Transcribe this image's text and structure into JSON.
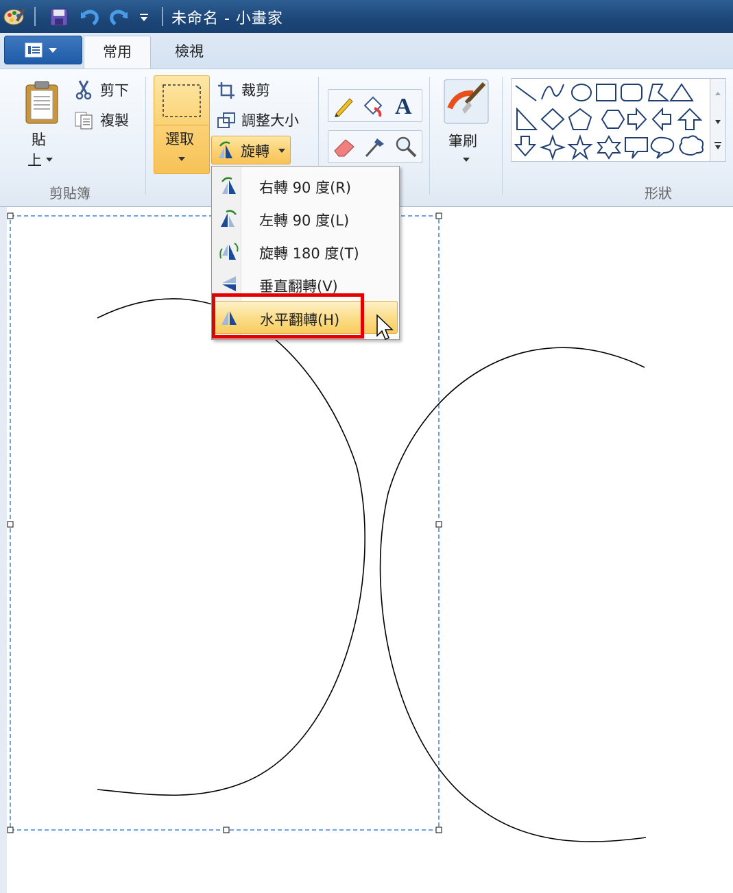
{
  "window": {
    "title": "未命名 - 小畫家"
  },
  "tabs": [
    {
      "label": "常用"
    },
    {
      "label": "檢視"
    }
  ],
  "clipboard": {
    "paste_label": "貼",
    "paste_sub": "上",
    "cut_label": "剪下",
    "copy_label": "複製",
    "group_label": "剪貼簿"
  },
  "image": {
    "select_label": "選取",
    "crop_label": "裁剪",
    "resize_label": "調整大小",
    "rotate_label": "旋轉"
  },
  "brushes": {
    "label": "筆刷"
  },
  "shapes": {
    "group_label": "形狀"
  },
  "rotate_menu": {
    "items": [
      {
        "label": "右轉 90 度(R)"
      },
      {
        "label": "左轉 90 度(L)"
      },
      {
        "label": "旋轉 180 度(T)"
      },
      {
        "label": "垂直翻轉(V)"
      },
      {
        "label": "水平翻轉(H)"
      }
    ],
    "highlighted_index": 4
  },
  "colors": {
    "ribbon_accent": "#fbd275",
    "title_bar": "#1c4678",
    "highlight_box": "#e50000",
    "selection": "#3b86d8"
  }
}
